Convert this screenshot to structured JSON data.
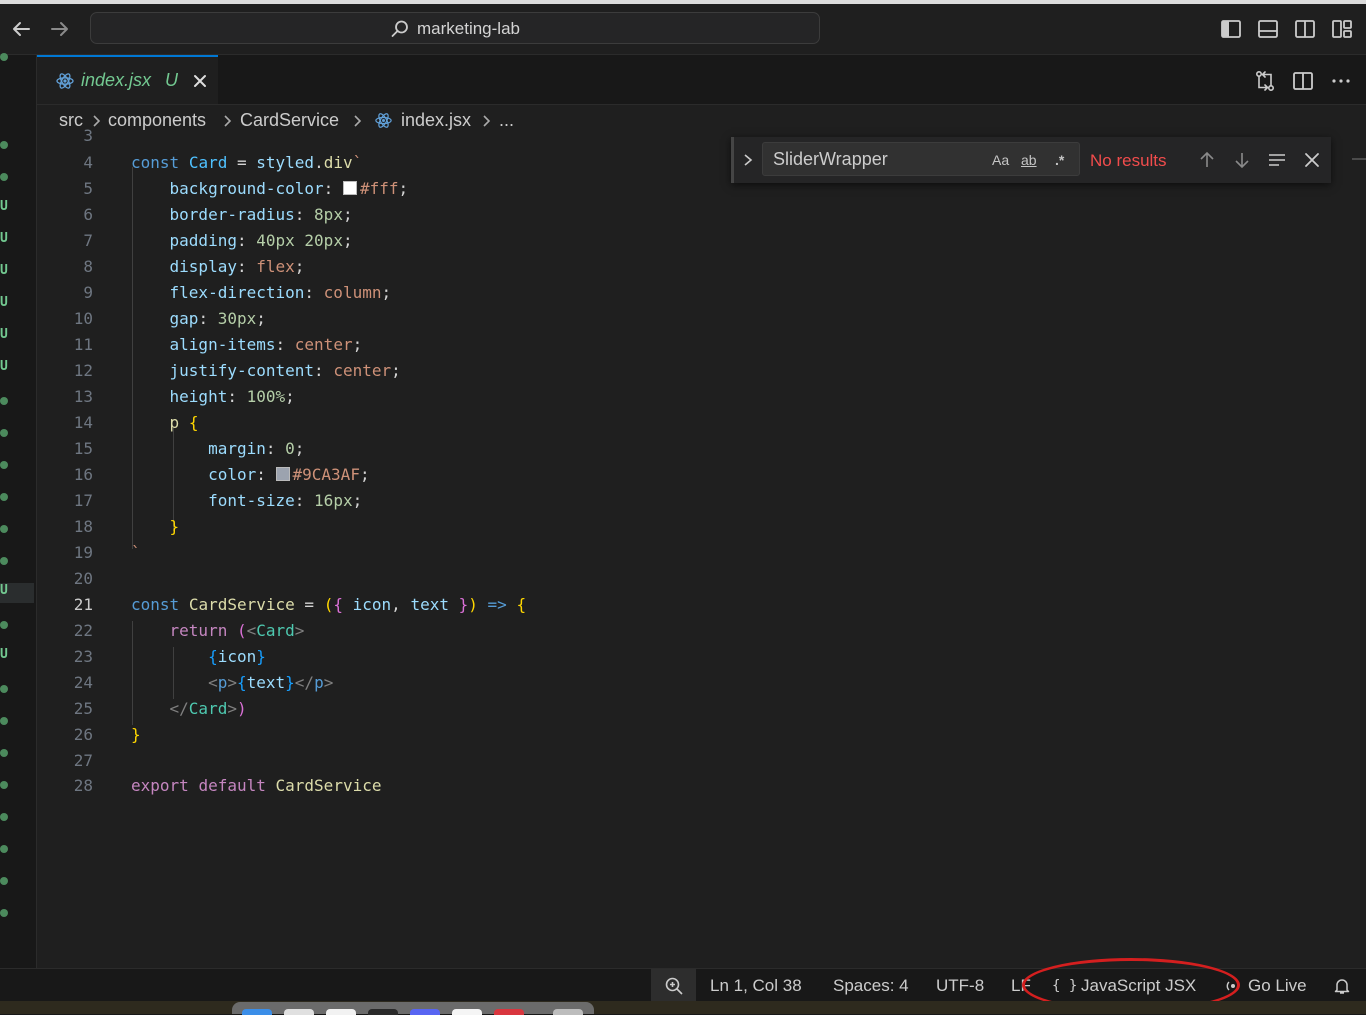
{
  "window": {
    "search_text": "marketing-lab"
  },
  "tab": {
    "name": "index.jsx",
    "status": "U"
  },
  "breadcrumb": [
    "src",
    "components",
    "CardService",
    "index.jsx",
    "..."
  ],
  "find": {
    "query": "SliderWrapper",
    "case_label": "Aa",
    "word_label": "ab",
    "regex_label": ".*",
    "result": "No results"
  },
  "code": {
    "line_numbers": [
      "3",
      "4",
      "5",
      "6",
      "7",
      "8",
      "9",
      "10",
      "11",
      "12",
      "13",
      "14",
      "15",
      "16",
      "17",
      "18",
      "19",
      "20",
      "21",
      "22",
      "23",
      "24",
      "25",
      "26",
      "27",
      "28"
    ]
  },
  "colors": {
    "white_swatch": "#ffffff",
    "gray_swatch": "#9CA3AF",
    "accent": "#0078d4",
    "git_untracked": "#73c991",
    "error": "#f14c4c",
    "annotation": "#d41f1f"
  },
  "status": {
    "position": "Ln 1, Col 38",
    "spaces": "Spaces: 4",
    "encoding": "UTF-8",
    "eol": "LF",
    "language_icon": "{ }",
    "language": "JavaScript JSX",
    "golive": "Go Live"
  },
  "activity_bar": {
    "marks": [
      "dot",
      "dot",
      "U",
      "U",
      "U",
      "U",
      "U",
      "U",
      "dot",
      "dot",
      "dot",
      "dot",
      "dot",
      "dot",
      "U",
      "dot",
      "U",
      "dot",
      "dot",
      "dot",
      "dot",
      "dot",
      "dot",
      "dot",
      "dot"
    ],
    "mark_label": "U"
  }
}
